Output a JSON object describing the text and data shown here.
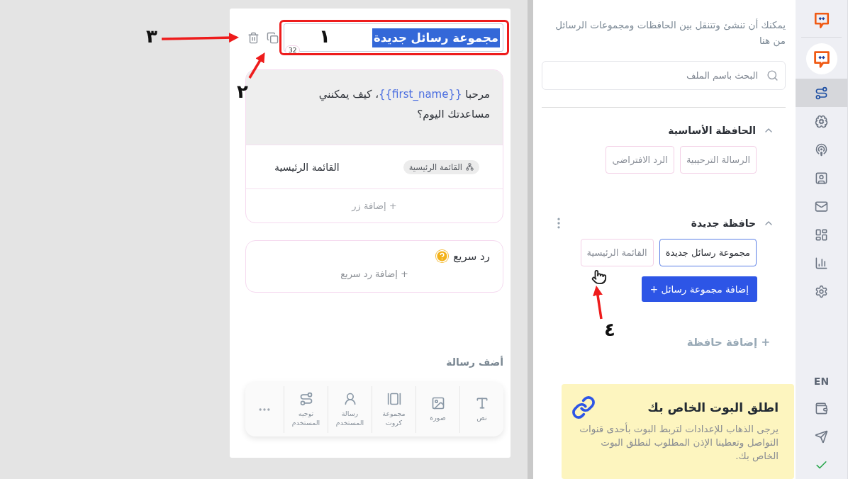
{
  "annotations": [
    {
      "label": "١"
    },
    {
      "label": "٢"
    },
    {
      "label": "٣"
    },
    {
      "label": "٤"
    }
  ],
  "editor": {
    "title": "مجموعة رسائل جديدة",
    "title_selected": true,
    "char_count": "32",
    "message": {
      "parts": [
        {
          "kind": "plain",
          "text": "مرحبا "
        },
        {
          "kind": "variable",
          "text": "{{first_name}}"
        },
        {
          "kind": "plain",
          "text": "، كيف يمكنني مساعدتك اليوم؟"
        }
      ],
      "buttons": [
        {
          "chip": "القائمة الرئيسية",
          "label": "القائمة الرئيسية"
        }
      ],
      "add_button": "+ إضافة زر"
    },
    "quick_reply": {
      "title": "رد سريع",
      "add_button": "+ إضافة رد سريع"
    },
    "add_message": {
      "title": "أضف رسالة",
      "tools": [
        {
          "kind": "text",
          "label": "نص"
        },
        {
          "kind": "image",
          "label": "صورة"
        },
        {
          "kind": "cards",
          "label": "مجموعة كروت"
        },
        {
          "kind": "user_message",
          "label": "رسالة المستخدم"
        },
        {
          "kind": "redirect",
          "label": "توجيه المستخدم"
        }
      ]
    }
  },
  "files_panel": {
    "intro": "يمكنك أن تنشئ وتتنقل بين الحافظات ومجموعات الرسائل من هنا",
    "search": {
      "placeholder": "البحث باسم الملف"
    },
    "folders": [
      {
        "title": "الحافظة الأساسية",
        "expanded": true,
        "menu": false,
        "items": [
          {
            "label": "الرسالة الترحيبية",
            "selected": false
          },
          {
            "label": "الرد الافتراضي",
            "selected": false
          }
        ]
      },
      {
        "title": "حافظة جديدة",
        "expanded": true,
        "menu": true,
        "items": [
          {
            "label": "مجموعة رسائل جديدة",
            "selected": true
          },
          {
            "label": "القائمة الرئيسية",
            "selected": false
          }
        ],
        "add_button": "إضافة مجموعة رسائل +"
      }
    ],
    "add_folder": "+ إضافة حافظة",
    "promo": {
      "title": "اطلق البوت الخاص بك",
      "text": "يرجى الذهاب للإعدادات لتربط البوت بأحدى قنوات التواصل وتعطينا الإذن المطلوب لنطلق البوت الخاص بك."
    }
  },
  "sidebar": {
    "items": [
      {
        "kind": "flow",
        "selected": true
      },
      {
        "kind": "ai",
        "selected": false
      },
      {
        "kind": "broadcast",
        "selected": false
      },
      {
        "kind": "contacts",
        "selected": false
      },
      {
        "kind": "mail",
        "selected": false
      },
      {
        "kind": "widgets",
        "selected": false
      },
      {
        "kind": "reports",
        "selected": false
      },
      {
        "kind": "settings",
        "selected": false
      }
    ],
    "language": "EN",
    "bottom_items": [
      {
        "kind": "wallet"
      },
      {
        "kind": "send"
      },
      {
        "kind": "check"
      }
    ]
  }
}
